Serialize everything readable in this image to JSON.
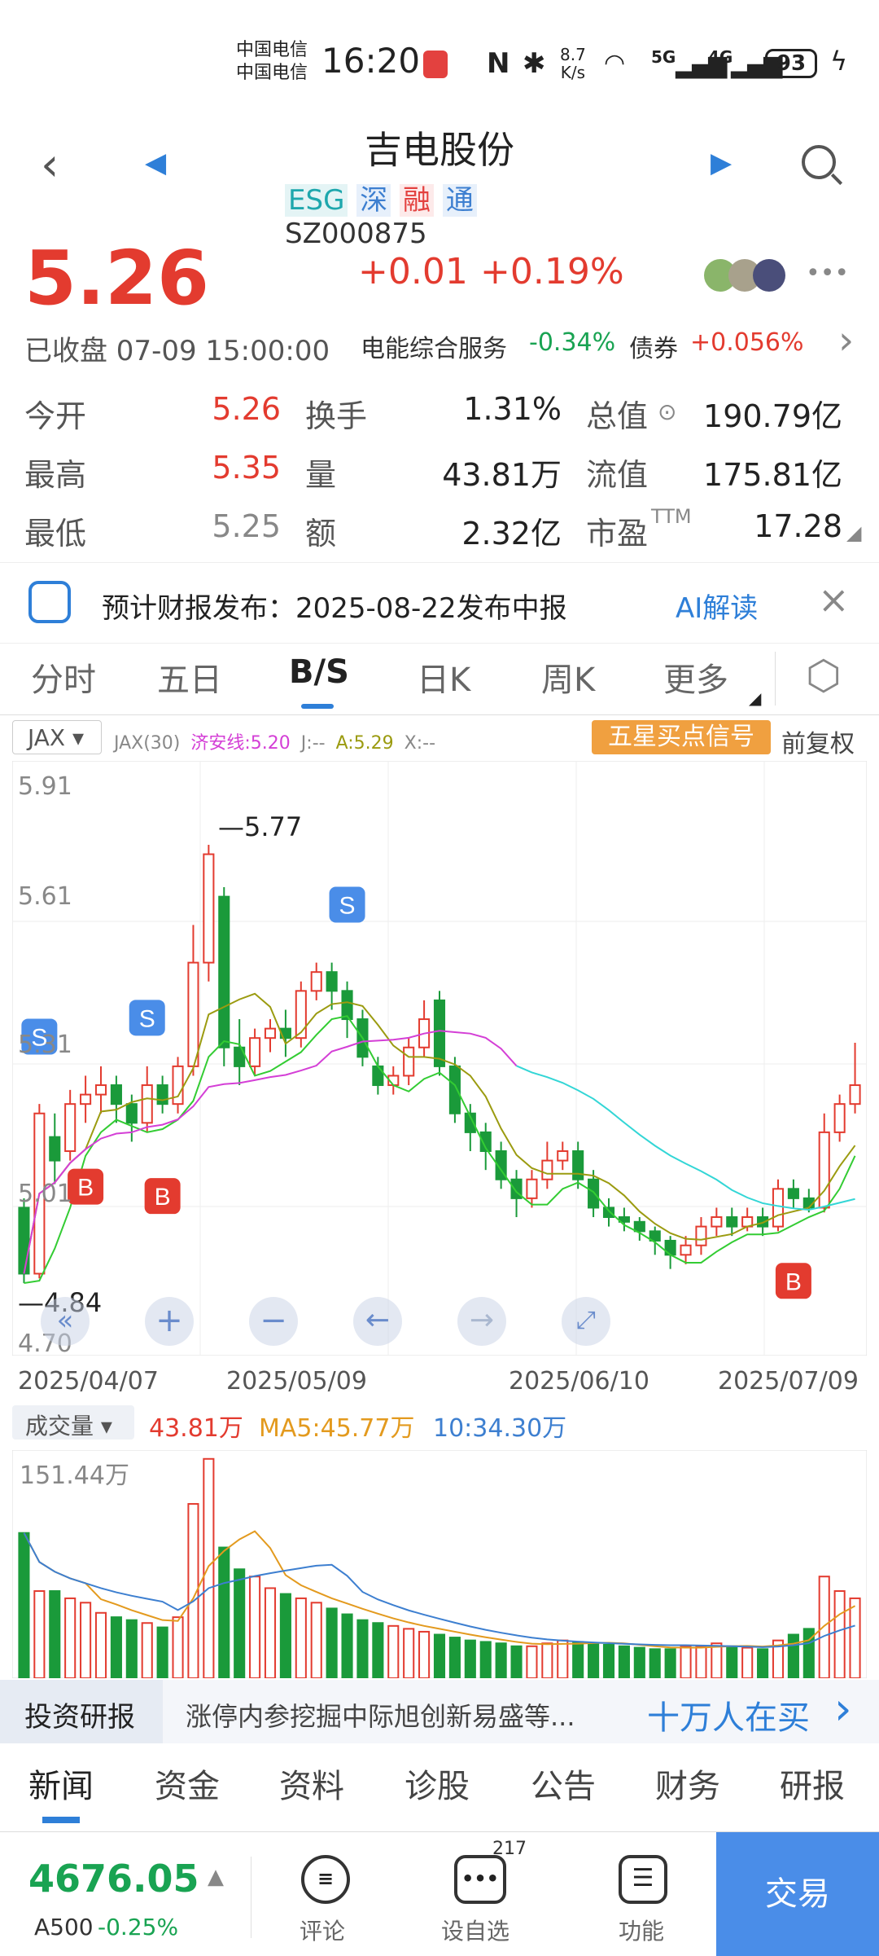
{
  "status": {
    "carrier1": "中国电信",
    "carrier2": "中国电信",
    "time": "16:20",
    "speed_top": "8.7",
    "speed_bottom": "K/s",
    "net1": "5G",
    "net2": "4G",
    "battery": "93"
  },
  "header": {
    "title": "吉电股份",
    "tags": [
      "ESG",
      "深",
      "融",
      "通"
    ],
    "code": "SZ000875"
  },
  "quote": {
    "price": "5.26",
    "change": "+0.01",
    "change_pct": "+0.19%",
    "status": "已收盘 07-09 15:00:00",
    "sector": "电能综合服务",
    "sector_pct": "-0.34%",
    "bond": "债券",
    "bond_pct": "+0.056%"
  },
  "stats": {
    "open_label": "今开",
    "open": "5.26",
    "turn_label": "换手",
    "turn": "1.31%",
    "mcap_label": "总值",
    "mcap": "190.79亿",
    "high_label": "最高",
    "high": "5.35",
    "vol_label": "量",
    "vol": "43.81万",
    "float_label": "流值",
    "float": "175.81亿",
    "low_label": "最低",
    "low": "5.25",
    "amt_label": "额",
    "amt": "2.32亿",
    "pe_label": "市盈",
    "pe_sup": "TTM",
    "pe": "17.28"
  },
  "banner": {
    "text": "预计财报发布：2025-08-22发布中报",
    "ai": "AI解读"
  },
  "tabs": [
    "分时",
    "五日",
    "B/S",
    "日K",
    "周K",
    "更多"
  ],
  "chart": {
    "indicator": "JAX",
    "ind_params": "JAX(30)",
    "jian": "济安线:5.20",
    "j": "J:--",
    "a": "A:5.29",
    "x": "X:--",
    "signal_btn": "五星买点信号",
    "adjust": "前复权",
    "y_labels": [
      "5.91",
      "5.61",
      "5.31",
      "5.01",
      "4.70"
    ],
    "max_label": "5.77",
    "min_label": "4.84",
    "dates": [
      "2025/04/07",
      "2025/05/09",
      "2025/06/10",
      "2025/07/09"
    ],
    "vol_label": "成交量",
    "vol_val": "43.81万",
    "ma5": "MA5:45.77万",
    "ma10": "10:34.30万",
    "vol_max": "151.44万"
  },
  "chart_data": {
    "type": "candlestick",
    "ylim": [
      4.7,
      5.91
    ],
    "candles": [
      [
        5.0,
        4.86,
        5.02,
        4.84
      ],
      [
        4.86,
        5.2,
        5.22,
        4.85
      ],
      [
        5.15,
        5.1,
        5.2,
        5.05
      ],
      [
        5.12,
        5.22,
        5.25,
        5.1
      ],
      [
        5.22,
        5.24,
        5.28,
        5.18
      ],
      [
        5.24,
        5.26,
        5.3,
        5.2
      ],
      [
        5.26,
        5.22,
        5.28,
        5.18
      ],
      [
        5.22,
        5.18,
        5.24,
        5.14
      ],
      [
        5.18,
        5.26,
        5.3,
        5.16
      ],
      [
        5.26,
        5.22,
        5.28,
        5.2
      ],
      [
        5.22,
        5.3,
        5.32,
        5.2
      ],
      [
        5.3,
        5.52,
        5.6,
        5.28
      ],
      [
        5.52,
        5.75,
        5.77,
        5.48
      ],
      [
        5.66,
        5.34,
        5.68,
        5.3
      ],
      [
        5.34,
        5.3,
        5.4,
        5.26
      ],
      [
        5.3,
        5.36,
        5.38,
        5.28
      ],
      [
        5.36,
        5.38,
        5.4,
        5.33
      ],
      [
        5.38,
        5.36,
        5.42,
        5.32
      ],
      [
        5.36,
        5.46,
        5.48,
        5.34
      ],
      [
        5.46,
        5.5,
        5.52,
        5.44
      ],
      [
        5.5,
        5.46,
        5.52,
        5.42
      ],
      [
        5.46,
        5.4,
        5.48,
        5.36
      ],
      [
        5.4,
        5.32,
        5.42,
        5.3
      ],
      [
        5.3,
        5.26,
        5.32,
        5.24
      ],
      [
        5.26,
        5.28,
        5.3,
        5.24
      ],
      [
        5.28,
        5.34,
        5.36,
        5.26
      ],
      [
        5.34,
        5.4,
        5.44,
        5.32
      ],
      [
        5.44,
        5.3,
        5.46,
        5.28
      ],
      [
        5.3,
        5.2,
        5.32,
        5.18
      ],
      [
        5.2,
        5.16,
        5.22,
        5.12
      ],
      [
        5.16,
        5.12,
        5.18,
        5.08
      ],
      [
        5.12,
        5.06,
        5.14,
        5.04
      ],
      [
        5.06,
        5.02,
        5.08,
        4.98
      ],
      [
        5.02,
        5.06,
        5.08,
        5.0
      ],
      [
        5.06,
        5.1,
        5.14,
        5.04
      ],
      [
        5.1,
        5.12,
        5.14,
        5.08
      ],
      [
        5.12,
        5.06,
        5.14,
        5.04
      ],
      [
        5.06,
        5.0,
        5.08,
        4.98
      ],
      [
        5.0,
        4.98,
        5.02,
        4.96
      ],
      [
        4.98,
        4.97,
        5.0,
        4.95
      ],
      [
        4.97,
        4.95,
        4.98,
        4.93
      ],
      [
        4.95,
        4.93,
        4.96,
        4.9
      ],
      [
        4.93,
        4.9,
        4.94,
        4.87
      ],
      [
        4.9,
        4.92,
        4.94,
        4.88
      ],
      [
        4.92,
        4.96,
        4.98,
        4.9
      ],
      [
        4.96,
        4.98,
        5.0,
        4.94
      ],
      [
        4.98,
        4.96,
        5.0,
        4.94
      ],
      [
        4.96,
        4.98,
        5.0,
        4.95
      ],
      [
        4.98,
        4.96,
        5.0,
        4.94
      ],
      [
        4.96,
        5.04,
        5.06,
        4.95
      ],
      [
        5.04,
        5.02,
        5.06,
        5.0
      ],
      [
        5.02,
        5.0,
        5.04,
        4.99
      ],
      [
        5.0,
        5.16,
        5.2,
        4.99
      ],
      [
        5.16,
        5.22,
        5.24,
        5.14
      ],
      [
        5.22,
        5.26,
        5.35,
        5.2
      ]
    ],
    "volumes": [
      100,
      60,
      60,
      55,
      52,
      45,
      42,
      40,
      38,
      35,
      42,
      120,
      151,
      90,
      75,
      70,
      62,
      58,
      55,
      52,
      48,
      44,
      40,
      38,
      36,
      34,
      32,
      30,
      28,
      26,
      25,
      24,
      22,
      22,
      24,
      26,
      25,
      24,
      23,
      22,
      21,
      20,
      20,
      22,
      22,
      24,
      22,
      21,
      20,
      26,
      30,
      34,
      70,
      60,
      55
    ],
    "volume_ylim": [
      0,
      151.44
    ]
  },
  "bottom_tabs": {
    "research": "投资研报",
    "ticker": "涨停内参挖掘中际旭创新易盛等...",
    "buyers": "十万人在买",
    "items": [
      "新闻",
      "资金",
      "资料",
      "诊股",
      "公告",
      "财务",
      "研报"
    ]
  },
  "bottombar": {
    "index_val": "4676.05",
    "index_name": "A500",
    "index_pct": "-0.25%",
    "comment": "评论",
    "watch": "设自选",
    "watch_count": "217",
    "func": "功能",
    "trade": "交易"
  }
}
